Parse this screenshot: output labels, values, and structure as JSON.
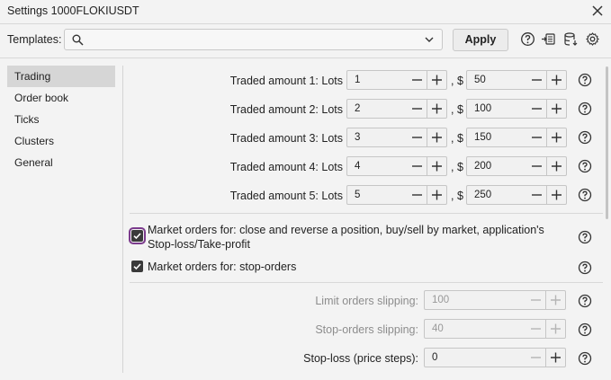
{
  "window": {
    "title": "Settings 1000FLOKIUSDT"
  },
  "templates": {
    "label": "Templates:",
    "value": "",
    "apply_label": "Apply"
  },
  "sidebar": {
    "items": [
      {
        "label": "Trading",
        "active": true
      },
      {
        "label": "Order book"
      },
      {
        "label": "Ticks"
      },
      {
        "label": "Clusters"
      },
      {
        "label": "General"
      }
    ]
  },
  "trading": {
    "amounts": [
      {
        "label": "Traded amount 1: Lots",
        "lots": "1",
        "usd": "50"
      },
      {
        "label": "Traded amount 2: Lots",
        "lots": "2",
        "usd": "100"
      },
      {
        "label": "Traded amount 3: Lots",
        "lots": "3",
        "usd": "150"
      },
      {
        "label": "Traded amount 4: Lots",
        "lots": "4",
        "usd": "200"
      },
      {
        "label": "Traded amount 5: Lots",
        "lots": "5",
        "usd": "250"
      }
    ],
    "currency_sep": ", $",
    "market_close_label": "Market orders for: close and reverse a position, buy/sell by market, application's Stop-loss/Take-profit",
    "market_close_checked": true,
    "market_stop_label": "Market orders for: stop-orders",
    "market_stop_checked": true,
    "limit_slip_label": "Limit orders slipping:",
    "limit_slip_value": "100",
    "stop_slip_label": "Stop-orders slipping:",
    "stop_slip_value": "40",
    "stoploss_label": "Stop-loss (price steps):",
    "stoploss_value": "0"
  },
  "colors": {
    "accent_focus": "#7b3b8c",
    "checkbox": "#3a3a3a"
  }
}
